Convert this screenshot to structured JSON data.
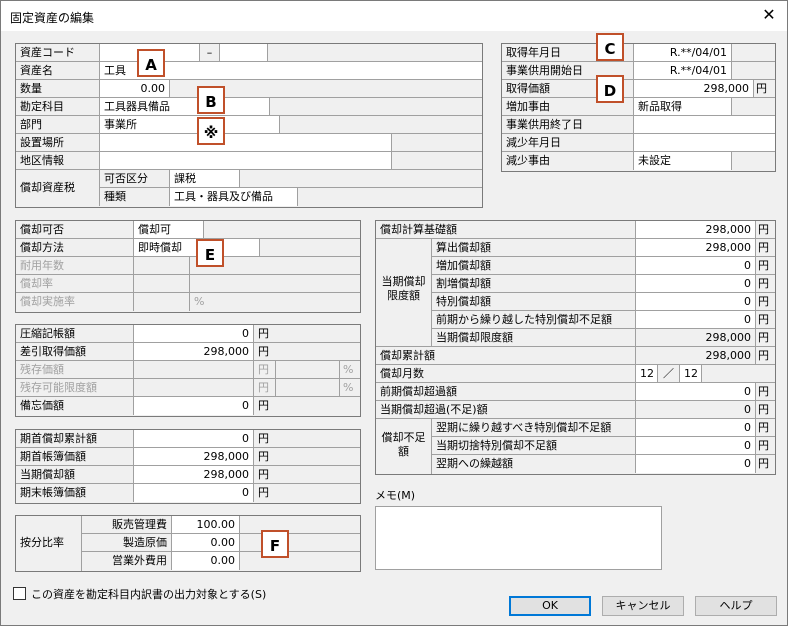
{
  "window": {
    "title": "固定資産の編集",
    "close": "✕"
  },
  "asset_info": {
    "asset_code_label": "資産コード",
    "asset_code_value": "",
    "asset_code_sep": "–",
    "asset_code_suffix": "",
    "asset_name_label": "資産名",
    "asset_name_value": "工具",
    "quantity_label": "数量",
    "quantity_value": "0.00",
    "account_label": "勘定科目",
    "account_value": "工具器具備品",
    "department_label": "部門",
    "department_value": "事業所",
    "location_label": "設置場所",
    "location_value": "",
    "district_label": "地区情報",
    "district_value": "",
    "dep_tax_label": "償却資産税",
    "tax_class_label": "可否区分",
    "tax_class_value": "課税",
    "kind_label": "種類",
    "kind_value": "工具・器具及び備品"
  },
  "acquisition": {
    "acq_date_label": "取得年月日",
    "acq_date_value": "R.**/04/01",
    "use_start_label": "事業供用開始日",
    "use_start_value": "R.**/04/01",
    "acq_price_label": "取得価額",
    "acq_price_value": "298,000",
    "acq_price_unit": "円",
    "increase_reason_label": "増加事由",
    "increase_reason_value": "新品取得",
    "use_end_label": "事業供用終了日",
    "use_end_value": "",
    "decrease_date_label": "減少年月日",
    "decrease_date_value": "",
    "decrease_reason_label": "減少事由",
    "decrease_reason_value": "未設定"
  },
  "depreciation": {
    "possible_label": "償却可否",
    "possible_value": "償却可",
    "method_label": "償却方法",
    "method_value": "即時償却",
    "life_label": "耐用年数",
    "rate_label": "償却率",
    "impl_rate_label": "償却実施率",
    "impl_rate_unit": "%"
  },
  "book": {
    "compress_label": "圧縮記帳額",
    "compress_value": "0",
    "net_acq_label": "差引取得価額",
    "net_acq_value": "298,000",
    "residual_label": "残存価額",
    "residual_limit_label": "残存可能限度額",
    "memo_price_label": "備忘価額",
    "memo_price_value": "0",
    "unit": "円",
    "pct": "%"
  },
  "period": {
    "open_acc_label": "期首償却累計額",
    "open_acc_value": "0",
    "open_book_label": "期首帳簿価額",
    "open_book_value": "298,000",
    "cur_dep_label": "当期償却額",
    "cur_dep_value": "298,000",
    "close_book_label": "期末帳簿価額",
    "close_book_value": "0"
  },
  "allocation": {
    "label": "按分比率",
    "sga_label": "販売管理費",
    "sga_value": "100.00",
    "mfg_label": "製造原価",
    "mfg_value": "0.00",
    "nonop_label": "営業外費用",
    "nonop_value": "0.00"
  },
  "calc": {
    "base_label": "償却計算基礎額",
    "base_value": "298,000",
    "limit_group_label": "当期償却限度額",
    "computed_label": "算出償却額",
    "computed_value": "298,000",
    "increased_label": "増加償却額",
    "increased_value": "0",
    "premium_label": "割増償却額",
    "premium_value": "0",
    "special_label": "特別償却額",
    "special_value": "0",
    "carried_label": "前期から繰り越した特別償却不足額",
    "carried_value": "0",
    "cur_limit_label": "当期償却限度額",
    "cur_limit_value": "298,000",
    "accum_label": "償却累計額",
    "accum_value": "298,000",
    "months_label": "償却月数",
    "months_value": "12",
    "months_sep": "／",
    "months_total": "12",
    "prev_excess_label": "前期償却超過額",
    "prev_excess_value": "0",
    "cur_excess_label": "当期償却超過(不足)額",
    "cur_excess_value": "0",
    "short_group_label": "償却不足額",
    "next_carry_label": "翌期に繰り越すべき特別償却不足額",
    "next_carry_value": "0",
    "cut_label": "当期切捨特別償却不足額",
    "cut_value": "0",
    "next_forward_label": "翌期への繰越額",
    "next_forward_value": "0",
    "unit": "円"
  },
  "memo": {
    "label": "メモ(M)",
    "value": ""
  },
  "checkbox_label": "この資産を勘定科目内訳書の出力対象とする(S)",
  "buttons": {
    "ok": "OK",
    "cancel": "キャンセル",
    "help": "ヘルプ"
  },
  "markers": {
    "a": "A",
    "b": "B",
    "c": "C",
    "d": "D",
    "e": "E",
    "f": "F",
    "note": "※"
  },
  "colors": {
    "marker_border": "#c0502a",
    "default_button_border": "#0078d7"
  }
}
